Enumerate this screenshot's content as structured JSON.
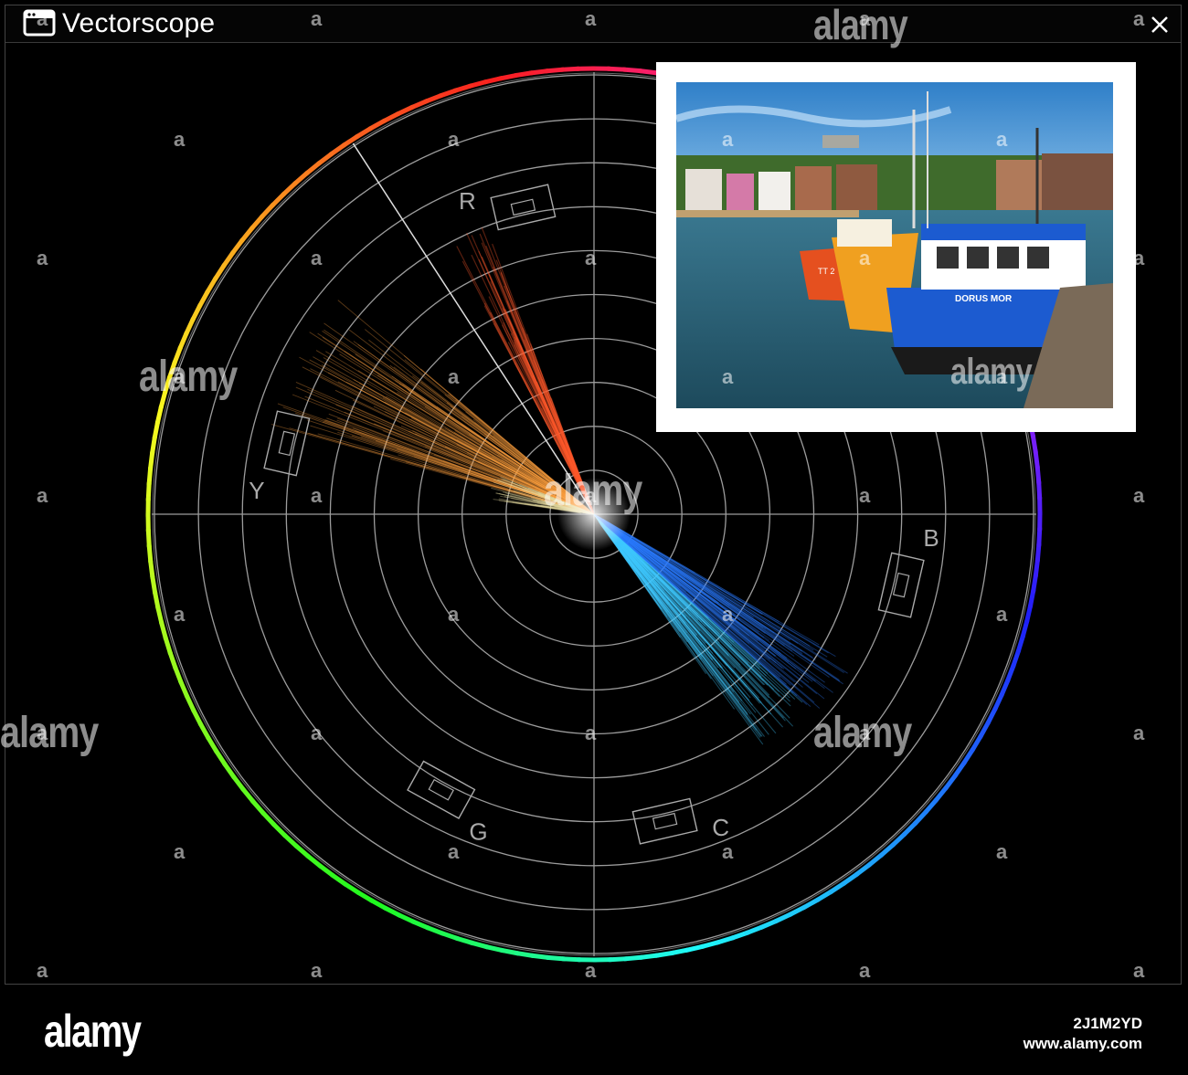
{
  "window": {
    "title": "Vectorscope"
  },
  "icons": {
    "app": "window-icon",
    "close": "close-icon"
  },
  "scope": {
    "targets": [
      {
        "label": "R",
        "angle_deg": 103
      },
      {
        "label": "Y",
        "angle_deg": 167
      },
      {
        "label": "G",
        "angle_deg": 241
      },
      {
        "label": "C",
        "angle_deg": 283
      },
      {
        "label": "B",
        "angle_deg": 347
      }
    ],
    "graticule_rings": 10,
    "skin_tone_line_deg": 123,
    "colors": {
      "ring": "#ffffff",
      "grid": "#9c9c9c",
      "traces": [
        "#ff5a2a",
        "#ffa040",
        "#40c8ff",
        "#2a7bff"
      ]
    }
  },
  "photo": {
    "boat_label": "DORUS MOR",
    "boat_reg": "TT 2"
  },
  "watermark": {
    "text": "alamy",
    "glyph": "a"
  },
  "footer": {
    "brand": "alamy",
    "image_id": "2J1M2YD",
    "url": "www.alamy.com"
  }
}
